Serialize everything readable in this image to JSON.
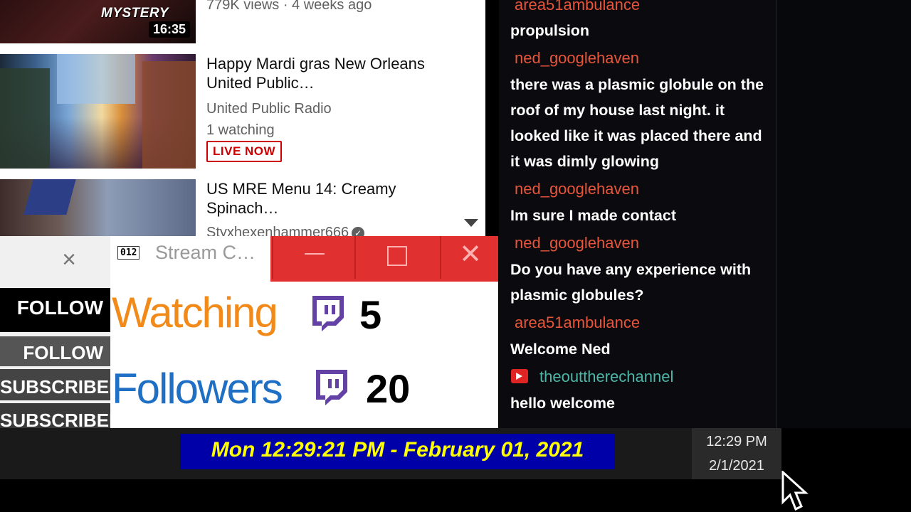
{
  "youtube": {
    "video_1": {
      "thumb_text": "MYSTERY",
      "duration": "16:35",
      "meta": "779K views · 4 weeks ago"
    },
    "video_2": {
      "title": "Happy Mardi gras New Orleans United Public…",
      "channel": "United Public Radio",
      "watching": "1 watching",
      "badge": "LIVE NOW"
    },
    "video_3": {
      "title": "US MRE Menu 14: Creamy Spinach…",
      "channel": "Styxhexenhammer666"
    }
  },
  "alerts": {
    "follow_1": "FOLLOW",
    "follow_2": "FOLLOW",
    "subscriber_1": "SUBSCRIBER",
    "subscriber_2": "SUBSCRIBER"
  },
  "counter_window": {
    "icon_text": "012",
    "title": "Stream C…",
    "watching_label": "Watching",
    "watching_value": "5",
    "followers_label": "Followers",
    "followers_value": "20",
    "colors": {
      "titlebar": "#e03030",
      "watching": "#f28a1a",
      "followers": "#1f6fc4",
      "twitch": "#6441a5"
    }
  },
  "chat": {
    "messages": [
      {
        "user": "area51ambulance",
        "text": "propulsion"
      },
      {
        "user": "ned_googlehaven",
        "text": "there was a plasmic globule on the roof of my house last night. it looked like it was placed there and it was dimly glowing"
      },
      {
        "user": "ned_googlehaven",
        "text": "Im sure I made contact"
      },
      {
        "user": "ned_googlehaven",
        "text": "Do you have any experience with plasmic globules?"
      },
      {
        "user": "area51ambulance",
        "text": "Welcome Ned"
      },
      {
        "user": "theouttherechannel",
        "text": "hello welcome",
        "icon": "camera-icon"
      }
    ]
  },
  "taskbar": {
    "date_banner": "Mon 12:29:21 PM - February 01, 2021",
    "tray_time": "12:29 PM",
    "tray_date": "2/1/2021"
  }
}
